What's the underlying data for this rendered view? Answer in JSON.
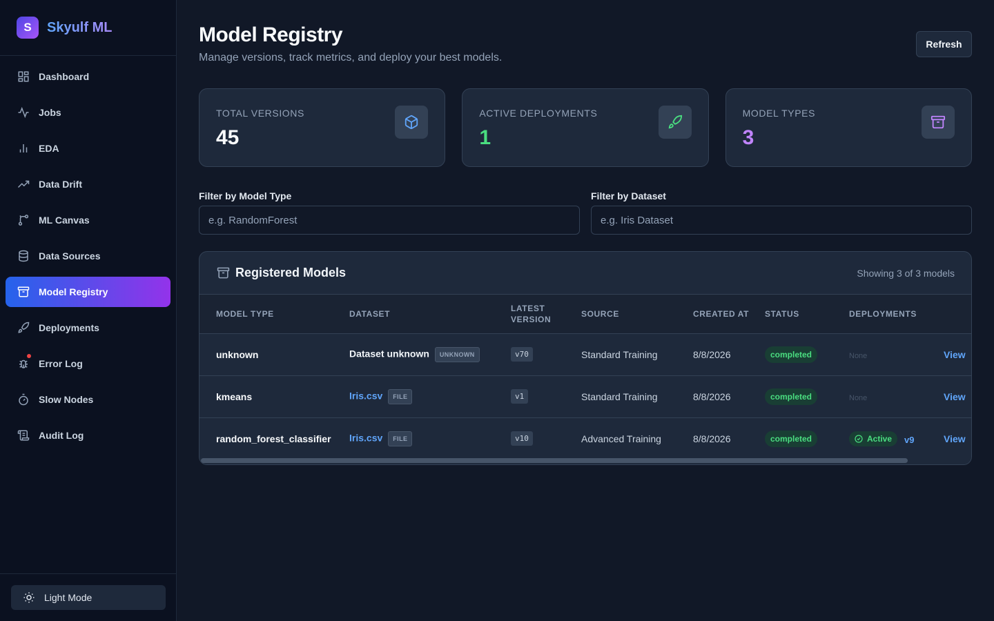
{
  "brand": {
    "logo_letter": "S",
    "name": "Skyulf ML"
  },
  "sidebar": {
    "items": [
      {
        "label": "Dashboard",
        "icon": "dashboard-icon"
      },
      {
        "label": "Jobs",
        "icon": "activity-icon"
      },
      {
        "label": "EDA",
        "icon": "bar-chart-icon"
      },
      {
        "label": "Data Drift",
        "icon": "trending-up-icon"
      },
      {
        "label": "ML Canvas",
        "icon": "git-branch-icon"
      },
      {
        "label": "Data Sources",
        "icon": "database-icon"
      },
      {
        "label": "Model Registry",
        "icon": "archive-icon",
        "active": true
      },
      {
        "label": "Deployments",
        "icon": "rocket-icon"
      },
      {
        "label": "Error Log",
        "icon": "bug-icon"
      },
      {
        "label": "Slow Nodes",
        "icon": "timer-icon"
      },
      {
        "label": "Audit Log",
        "icon": "scroll-icon"
      }
    ],
    "theme_toggle": "Light Mode"
  },
  "header": {
    "title": "Model Registry",
    "subtitle": "Manage versions, track metrics, and deploy your best models.",
    "refresh_label": "Refresh"
  },
  "stats": [
    {
      "label": "Total Versions",
      "value": "45",
      "color": "#f8fafc",
      "icon": "cube-icon"
    },
    {
      "label": "Active Deployments",
      "value": "1",
      "color": "#4ade80",
      "icon": "rocket-icon"
    },
    {
      "label": "Model Types",
      "value": "3",
      "color": "#c084fc",
      "icon": "archive-icon"
    }
  ],
  "filters": {
    "model_type": {
      "label": "Filter by Model Type",
      "placeholder": "e.g. RandomForest",
      "value": ""
    },
    "dataset": {
      "label": "Filter by Dataset",
      "placeholder": "e.g. Iris Dataset",
      "value": ""
    }
  },
  "table": {
    "title": "Registered Models",
    "count_text": "Showing 3 of 3 models",
    "columns": [
      "Model Type",
      "Dataset",
      "Latest Version",
      "Source",
      "Created At",
      "Status",
      "Deployments",
      ""
    ],
    "rows": [
      {
        "model_type": "unknown",
        "dataset": "Dataset unknown",
        "dataset_tag": "UNKNOWN",
        "version": "v70",
        "source": "Standard Training",
        "created": "8/8/2026",
        "status": "completed",
        "deployments": "None",
        "action": "View"
      },
      {
        "model_type": "kmeans",
        "dataset": "Iris.csv",
        "dataset_tag": "FILE",
        "version": "v1",
        "source": "Standard Training",
        "created": "8/8/2026",
        "status": "completed",
        "deployments": "None",
        "action": "View"
      },
      {
        "model_type": "random_forest_classifier",
        "dataset": "Iris.csv",
        "dataset_tag": "FILE",
        "version": "v10",
        "source": "Advanced Training",
        "created": "8/8/2026",
        "status": "completed",
        "deployments": "Active",
        "deployment_version": "v9",
        "action": "View"
      }
    ]
  },
  "colors": {
    "accent_blue": "#60a5fa",
    "success": "#4ade80",
    "purple": "#c084fc",
    "active_nav_from": "#2563eb",
    "active_nav_to": "#9333ea"
  }
}
